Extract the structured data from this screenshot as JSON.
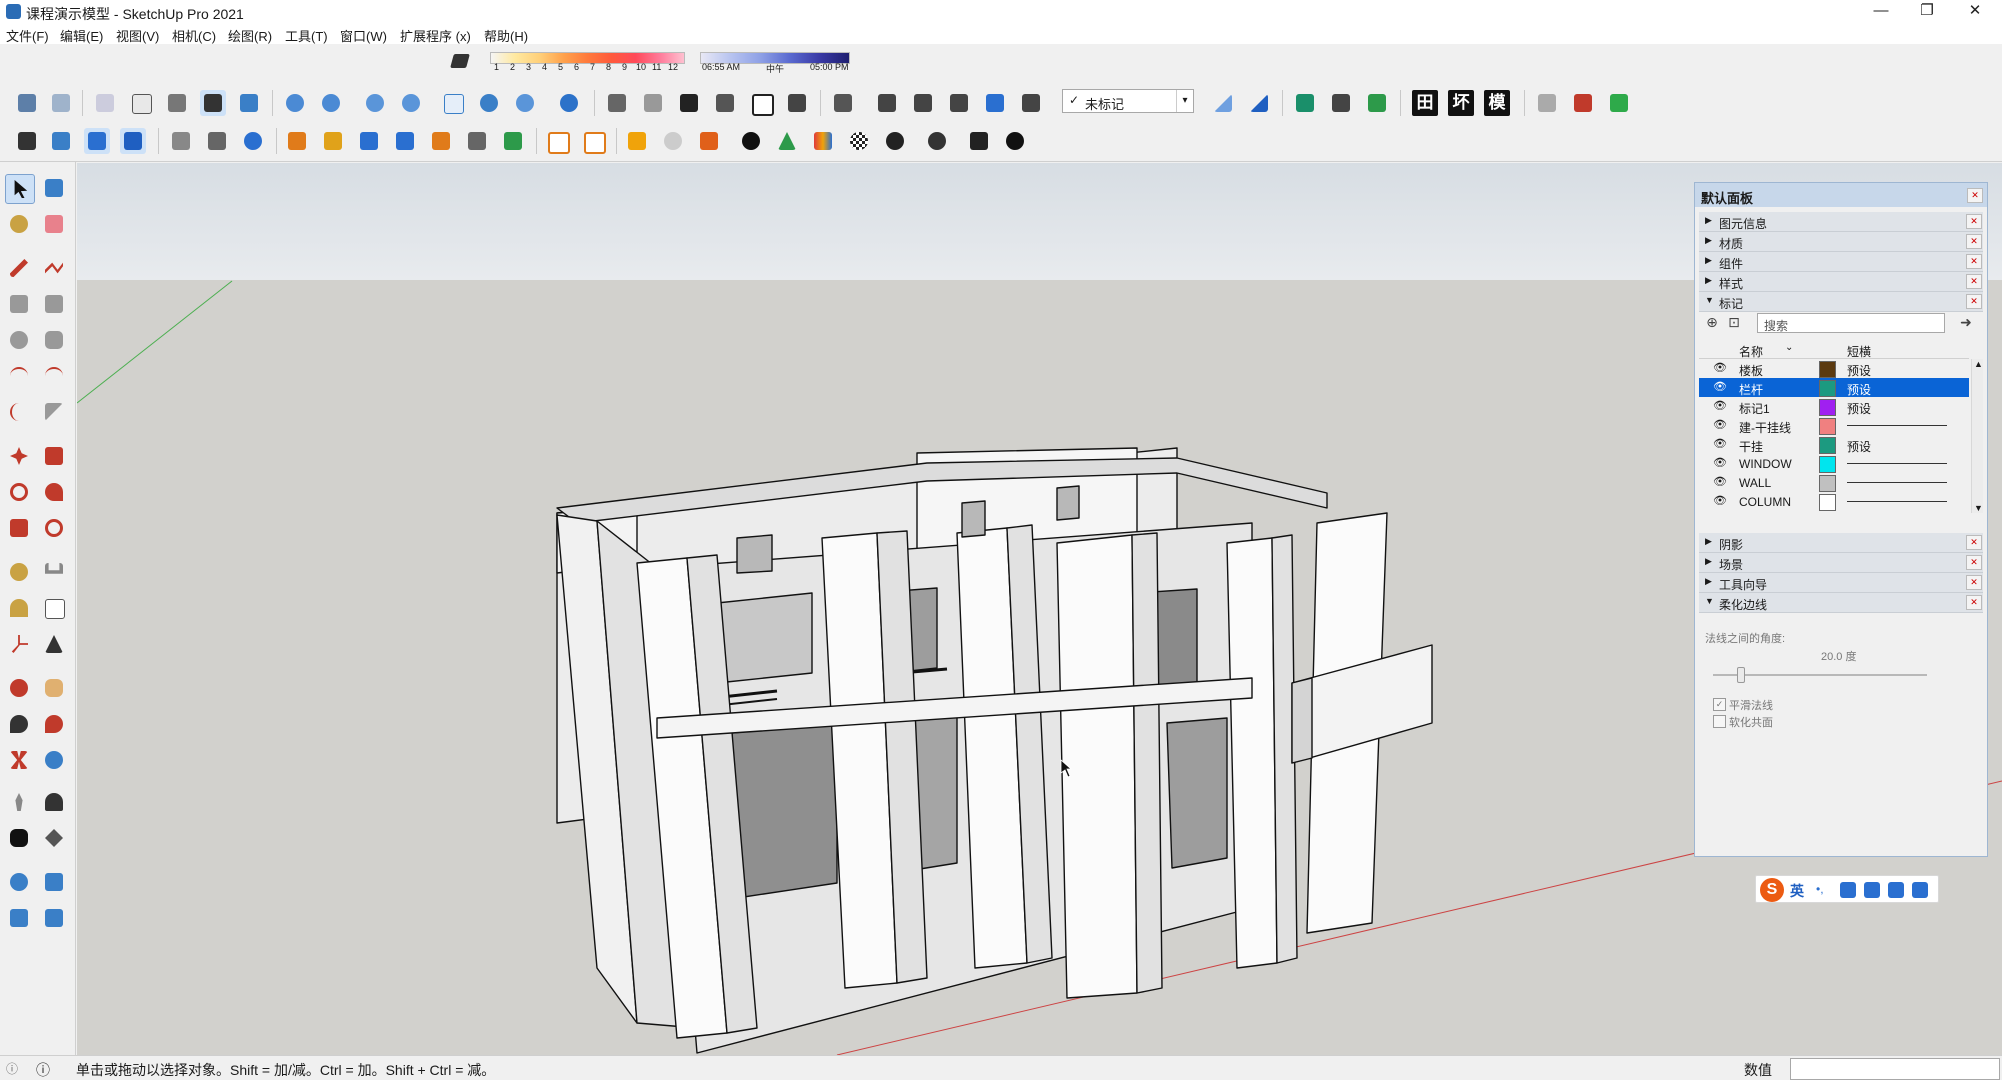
{
  "window": {
    "title": "课程演示模型 - SketchUp Pro 2021",
    "controls": [
      "—",
      "❐",
      "✕"
    ]
  },
  "menu": [
    "文件(F)",
    "编辑(E)",
    "视图(V)",
    "相机(C)",
    "绘图(R)",
    "工具(T)",
    "窗口(W)",
    "扩展程序 (x)",
    "帮助(H)"
  ],
  "shadow_settings": {
    "months": [
      "1",
      "2",
      "3",
      "4",
      "5",
      "6",
      "7",
      "8",
      "9",
      "10",
      "11",
      "12"
    ],
    "time_start": "06:55 AM",
    "time_mid": "中午",
    "time_end": "05:00 PM"
  },
  "toolbar": {
    "tag_select": "未标记",
    "tag_select_check": "✓",
    "cjk_buttons": [
      "田",
      "坏",
      "模"
    ]
  },
  "tray": {
    "title": "默认面板",
    "sections_top": [
      "图元信息",
      "材质",
      "组件",
      "样式"
    ],
    "tags_section": "标记",
    "tag_search_placeholder": "搜索",
    "tag_columns": {
      "name": "名称",
      "dash": "短横"
    },
    "tags": [
      {
        "name": "楼板",
        "color": "#5b3a10",
        "dash": "预设",
        "selected": false
      },
      {
        "name": "栏杆",
        "color": "#1c9a80",
        "dash": "预设",
        "selected": true
      },
      {
        "name": "标记1",
        "color": "#a020f0",
        "dash": "预设",
        "selected": false
      },
      {
        "name": "建-干挂线",
        "color": "#f08080",
        "dash": "",
        "selected": false
      },
      {
        "name": "干挂",
        "color": "#1c9a80",
        "dash": "预设",
        "selected": false
      },
      {
        "name": "WINDOW",
        "color": "#00e5ee",
        "dash": "",
        "selected": false
      },
      {
        "name": "WALL",
        "color": "#c0c0c0",
        "dash": "",
        "selected": false
      },
      {
        "name": "COLUMN",
        "color": "#ffffff",
        "dash": "",
        "selected": false
      }
    ],
    "sections_bottom": [
      "阴影",
      "场景",
      "工具向导"
    ],
    "soften_section": "柔化边线",
    "soften": {
      "angle_label": "法线之间的角度:",
      "angle_value": "20.0  度",
      "angle_degrees": 20.0,
      "smooth_normals": "平滑法线",
      "smooth_checked": true,
      "soften_coplanar": "软化共面",
      "coplanar_checked": false
    }
  },
  "ime": {
    "logo": "S",
    "mode": "英"
  },
  "statusbar": {
    "message": "单击或拖动以选择对象。Shift = 加/减。Ctrl = 加。Shift + Ctrl = 减。",
    "measure_label": "数值"
  }
}
